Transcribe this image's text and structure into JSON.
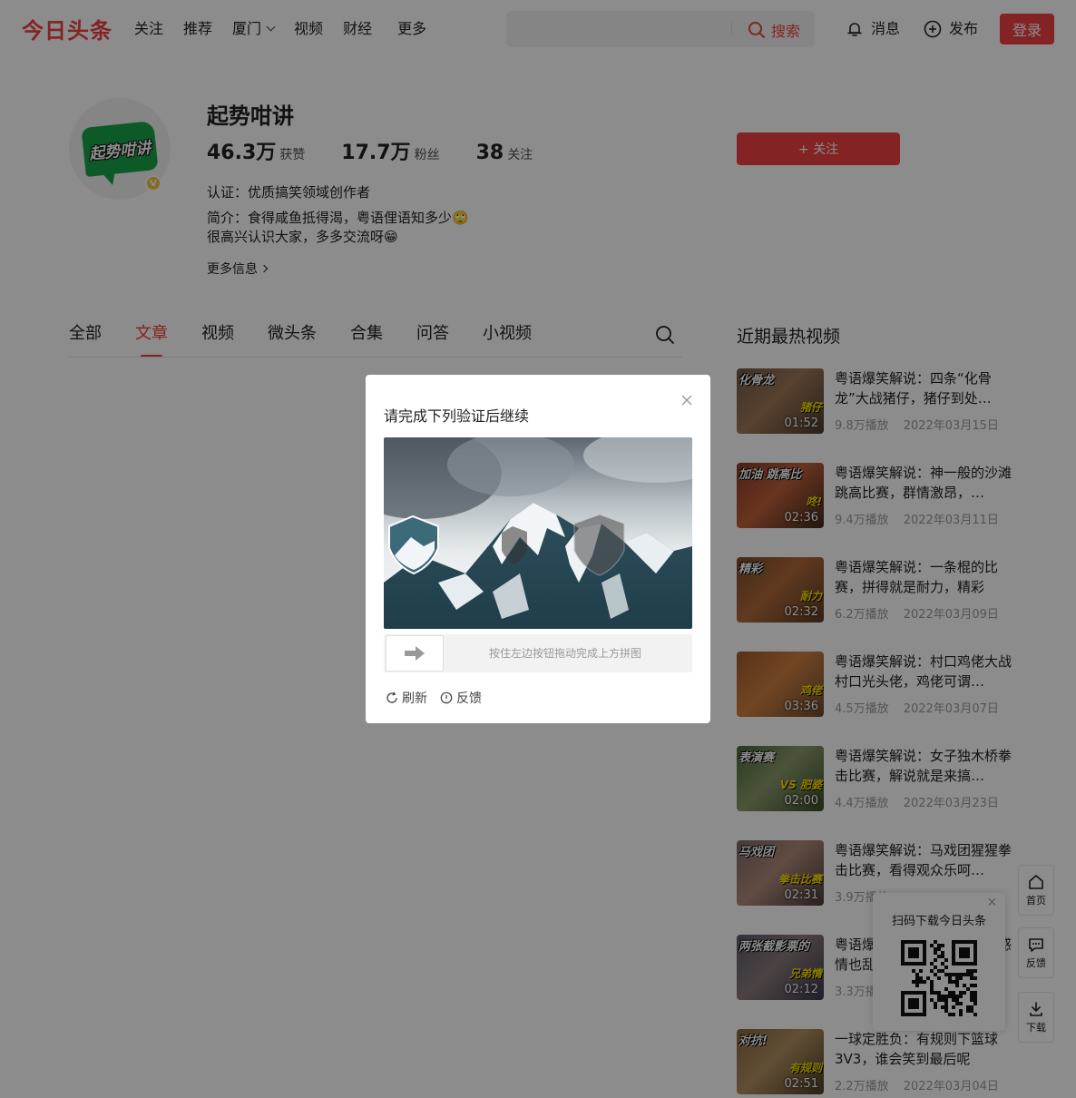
{
  "header": {
    "logo": "今日头条",
    "nav": [
      "关注",
      "推荐",
      "厦门",
      "视频",
      "财经",
      "更多"
    ],
    "search_label": "搜索",
    "messages": "消息",
    "publish": "发布",
    "login": "登录"
  },
  "profile": {
    "name": "起势咁讲",
    "avatar_text": "起势咁讲",
    "badge": "V",
    "likes_num": "46.3万",
    "likes_lbl": "获赞",
    "fans_num": "17.7万",
    "fans_lbl": "粉丝",
    "follow_num": "38",
    "follow_lbl": "关注",
    "cert": "认证：优质搞笑领域创作者",
    "bio1": "简介：食得咸鱼抵得渴，粤语俚语知多少🙄",
    "bio2": "很高兴认识大家，多多交流呀😁",
    "more": "更多信息",
    "follow_btn": "+ 关注"
  },
  "tabs": [
    {
      "label": "全部"
    },
    {
      "label": "文章",
      "active": true
    },
    {
      "label": "视频"
    },
    {
      "label": "微头条"
    },
    {
      "label": "合集"
    },
    {
      "label": "问答"
    },
    {
      "label": "小视频"
    }
  ],
  "sidebar": {
    "title": "近期最热视频",
    "videos": [
      {
        "title": "粤语爆笑解说：四条“化骨龙”大战猪仔，猪仔到处…",
        "plays": "9.8万播放",
        "date": "2022年03月15日",
        "duration": "01:52",
        "t1": "化骨龙",
        "t2": "猪仔"
      },
      {
        "title": "粤语爆笑解说：神一般的沙滩跳高比赛，群情激昂，…",
        "plays": "9.4万播放",
        "date": "2022年03月11日",
        "duration": "02:36",
        "t1": "加油 跳高比",
        "t2": "咚!"
      },
      {
        "title": "粤语爆笑解说：一条棍的比赛，拼得就是耐力，精彩",
        "plays": "6.2万播放",
        "date": "2022年03月09日",
        "duration": "02:32",
        "t1": "精彩",
        "t2": "耐力"
      },
      {
        "title": "粤语爆笑解说：村口鸡佬大战村口光头佬，鸡佬可谓…",
        "plays": "4.5万播放",
        "date": "2022年03月07日",
        "duration": "03:36",
        "t1": "",
        "t2": "鸡佬"
      },
      {
        "title": "粤语爆笑解说：女子独木桥拳击比赛，解说就是来搞…",
        "plays": "4.4万播放",
        "date": "2022年03月23日",
        "duration": "02:00",
        "t1": "表演赛",
        "t2": "VS 肥婆"
      },
      {
        "title": "粤语爆笑解说：马戏团猩猩拳击比赛，看得观众乐呵…",
        "plays": "3.9万播放",
        "date": "",
        "duration": "02:31",
        "t1": "马戏团",
        "t2": "拳击比赛"
      },
      {
        "title": "粤语爆笑解说：两张截影…感情也乱…",
        "plays": "3.3万播放",
        "date": "",
        "duration": "02:12",
        "t1": "两张截影票的",
        "t2": "兄弟情"
      },
      {
        "title": "一球定胜负：有规则下篮球3V3，谁会笑到最后呢",
        "plays": "2.2万播放",
        "date": "2022年03月04日",
        "duration": "02:51",
        "t1": "对抗!",
        "t2": "有规则"
      }
    ]
  },
  "toolbar": {
    "home": "首页",
    "feedback": "反馈",
    "download": "下载"
  },
  "captcha": {
    "title": "请完成下列验证后继续",
    "hint": "按住左边按钮拖动完成上方拼图",
    "refresh": "刷新",
    "feedback": "反馈",
    "slider_progress": 0
  },
  "qr": {
    "title": "扫码下载今日头条",
    "close": "×"
  }
}
